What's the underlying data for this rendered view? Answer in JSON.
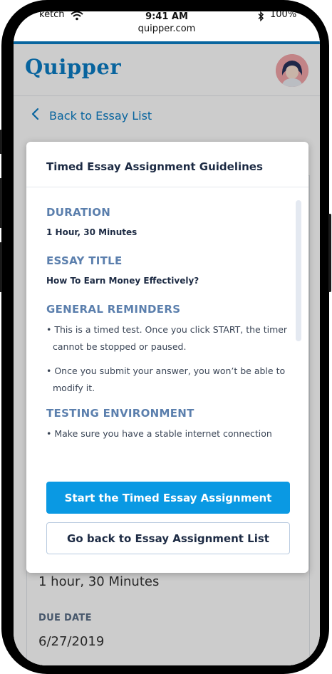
{
  "status_bar": {
    "carrier": "ketch",
    "time": "9:41 AM",
    "url": "quipper.com",
    "battery": "100%"
  },
  "header": {
    "logo": "Quipper"
  },
  "nav": {
    "back_label": "Back to Essay List"
  },
  "background_card": {
    "duration_value": "1 hour, 30 Minutes",
    "due_date_label": "DUE DATE",
    "due_date_value": "6/27/2019"
  },
  "modal": {
    "title": "Timed Essay Assignment Guidelines",
    "sections": [
      {
        "heading": "DURATION",
        "value": "1 Hour, 30 Minutes"
      },
      {
        "heading": "ESSAY TITLE",
        "value": "How To Earn Money Effectively?"
      },
      {
        "heading": "GENERAL REMINDERS",
        "bullets": [
          "• This is a timed test. Once you click START, the timer cannot be stopped or paused.",
          "• Once you submit your answer, you won’t be able to modify it."
        ]
      },
      {
        "heading": "TESTING ENVIRONMENT",
        "bullets": [
          "• Make sure you have a stable internet connection"
        ]
      }
    ],
    "primary_button": "Start the Timed Essay Assignment",
    "secondary_button": "Go back to Essay Assignment List"
  },
  "colors": {
    "brand": "#0b7ec6",
    "primary_button": "#0a99e3",
    "section_heading": "#5b7fad"
  }
}
